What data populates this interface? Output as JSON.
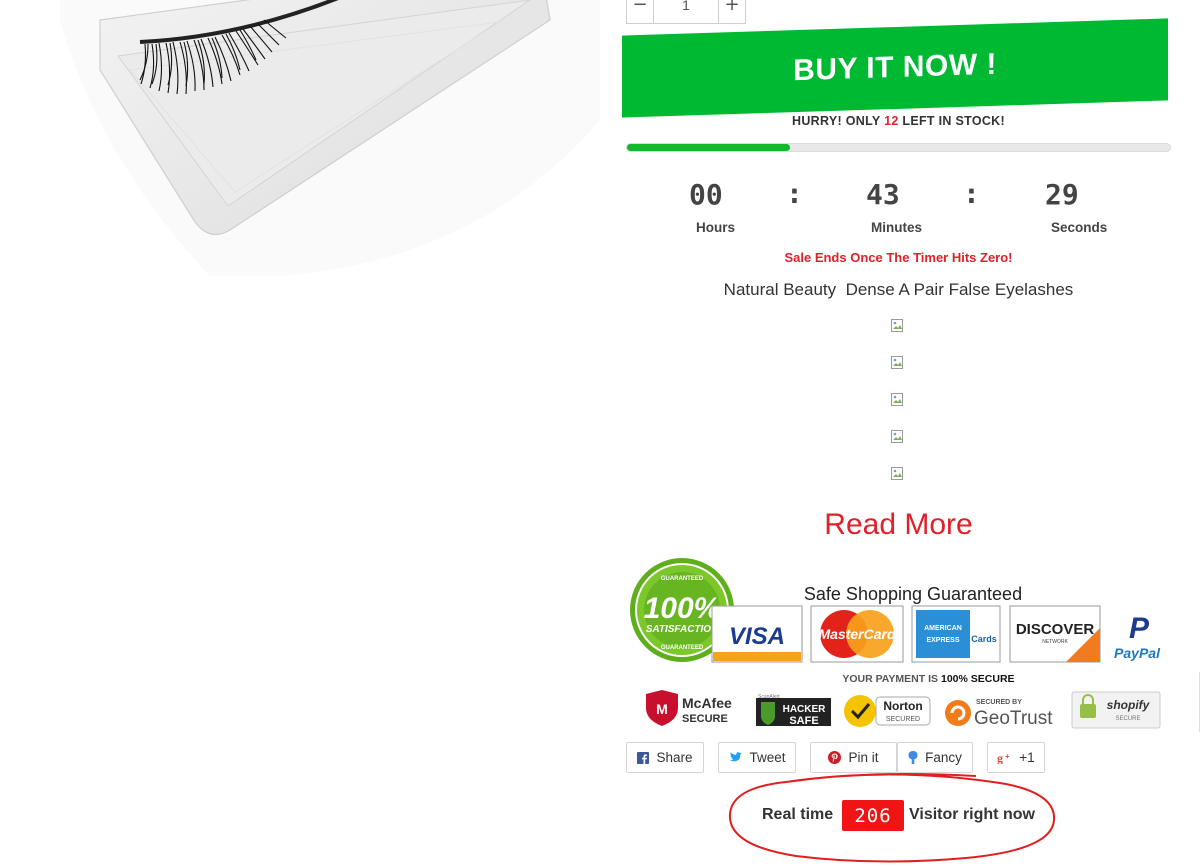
{
  "quantity": {
    "minus_label": "−",
    "value": "1",
    "plus_label": "+"
  },
  "buy_button": {
    "label": "BUY IT NOW !",
    "color": "#00b933"
  },
  "stock": {
    "prefix": "HURRY! ONLY",
    "count": "12",
    "suffix": "LEFT IN STOCK!",
    "fill_fraction": 0.3,
    "accent": "#d32a2a"
  },
  "timer": {
    "hours": "00",
    "minutes": "43",
    "seconds": "29",
    "separator": ":",
    "hours_label": "Hours",
    "minutes_label": "Minutes",
    "seconds_label": "Seconds"
  },
  "sale_notice": "Sale Ends Once The Timer Hits Zero!",
  "product_title": "Natural Beauty  Dense A Pair False Eyelashes",
  "read_more": "Read More",
  "badges": {
    "heading": "Safe Shopping Guaranteed",
    "satisfaction_top": "GUARANTEED",
    "satisfaction_main": "100%",
    "satisfaction_sub": "SATISFACTION",
    "satisfaction_bottom": "GUARANTEED",
    "visa": "VISA",
    "mastercard": "MasterCard",
    "amex_line1": "AMERICAN",
    "amex_line2": "EXPRESS",
    "amex_cards": "Cards",
    "discover": "DISCOVER",
    "discover_sub": "NETWORK",
    "paypal_letter": "P",
    "paypal": "PayPal",
    "payment_secure_prefix": "YOUR PAYMENT IS",
    "payment_secure_strong": "100% SECURE",
    "mcafee_line1": "McAfee",
    "mcafee_line2": "SECURE",
    "mcafee_letter": "M",
    "hacker_top": "ScanAlert",
    "hacker_line1": "HACKER",
    "hacker_line2": "SAFE",
    "norton_line1": "Norton",
    "norton_line2": "SECURED",
    "geotrust_top": "SECURED BY",
    "geotrust": "GeoTrust",
    "shopify": "shopify",
    "shopify_sub": "SECURE"
  },
  "social": {
    "share": "Share",
    "tweet": "Tweet",
    "pin": "Pin it",
    "fancy": "Fancy",
    "plusone": "+1"
  },
  "visitors": {
    "prefix": "Real time",
    "count": "206",
    "suffix": "Visitor right now"
  }
}
